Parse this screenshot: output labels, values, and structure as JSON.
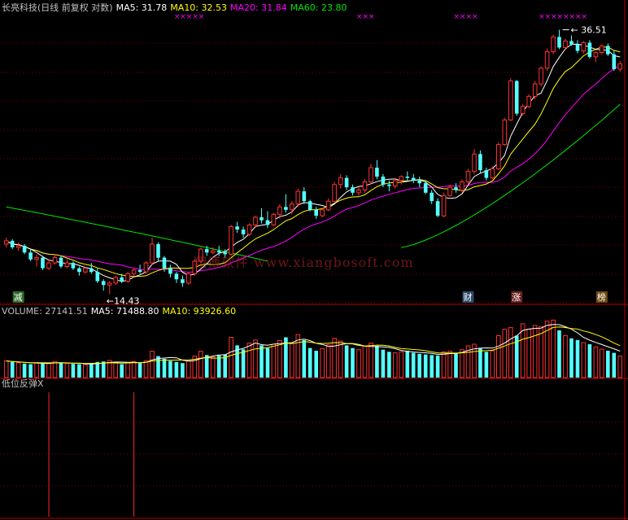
{
  "colors": {
    "background": "#000000",
    "up": "#ff3232",
    "down": "#54ffff",
    "frame": "#b00000",
    "ma5": "#ffffff",
    "ma10": "#ffff00",
    "ma20": "#ff00ff",
    "ma60": "#00e600",
    "title": "#c0c0c0",
    "signal": "#ff2020"
  },
  "header": {
    "title": "长亮科技(日线 前复权 对数)",
    "ma5": "MA5: 31.78",
    "ma10": "MA10: 32.53",
    "ma20": "MA20: 31.84",
    "ma60": "MA60: 23.80"
  },
  "volume_header": {
    "title": "VOLUME: 27141.51",
    "ma5": "MA5: 71488.80",
    "ma10": "MA10: 93926.60"
  },
  "indicator_header": {
    "title": "低位反弹X"
  },
  "watermark": "翔博软件 www.xiangbosoft.com",
  "chart_data": {
    "type": "candlestick",
    "annotations": {
      "high": "36.51",
      "low": "14.43"
    },
    "badges": [
      "减",
      "财",
      "涨",
      "榜"
    ],
    "price_range_visible": [
      14.0,
      38.5
    ],
    "candles": [
      [
        17.2,
        17.6,
        17.0,
        17.4
      ],
      [
        17.4,
        17.5,
        16.9,
        17.0
      ],
      [
        17.0,
        17.3,
        16.8,
        17.1
      ],
      [
        17.1,
        17.2,
        16.6,
        16.7
      ],
      [
        16.7,
        16.9,
        16.2,
        16.3
      ],
      [
        16.3,
        16.6,
        15.9,
        16.4
      ],
      [
        16.4,
        16.5,
        15.7,
        15.8
      ],
      [
        15.8,
        16.3,
        15.7,
        16.1
      ],
      [
        16.1,
        16.6,
        16.0,
        16.4
      ],
      [
        16.4,
        16.5,
        15.8,
        15.9
      ],
      [
        15.9,
        16.3,
        15.8,
        16.1
      ],
      [
        16.1,
        16.2,
        15.7,
        15.8
      ],
      [
        15.8,
        15.9,
        15.4,
        15.6
      ],
      [
        15.6,
        15.9,
        15.5,
        15.8
      ],
      [
        15.8,
        16.1,
        15.5,
        15.6
      ],
      [
        15.6,
        15.8,
        15.0,
        15.1
      ],
      [
        15.1,
        15.2,
        14.6,
        14.9
      ],
      [
        14.9,
        15.1,
        14.43,
        15.0
      ],
      [
        15.0,
        15.4,
        14.9,
        15.3
      ],
      [
        15.3,
        15.5,
        15.0,
        15.1
      ],
      [
        15.1,
        15.6,
        15.0,
        15.5
      ],
      [
        15.5,
        15.8,
        15.3,
        15.7
      ],
      [
        15.7,
        16.0,
        15.5,
        15.6
      ],
      [
        15.6,
        16.2,
        15.5,
        16.1
      ],
      [
        16.1,
        17.6,
        16.0,
        17.2
      ],
      [
        17.2,
        17.3,
        16.2,
        16.4
      ],
      [
        16.4,
        16.5,
        15.6,
        15.8
      ],
      [
        15.8,
        16.0,
        15.3,
        15.5
      ],
      [
        15.5,
        15.6,
        15.0,
        15.2
      ],
      [
        15.2,
        15.4,
        14.8,
        15.0
      ],
      [
        15.0,
        15.6,
        14.9,
        15.5
      ],
      [
        15.5,
        16.3,
        15.4,
        16.2
      ],
      [
        16.2,
        17.0,
        16.1,
        16.9
      ],
      [
        16.9,
        17.1,
        16.5,
        16.7
      ],
      [
        16.7,
        17.0,
        16.6,
        16.8
      ],
      [
        16.8,
        17.1,
        16.5,
        16.7
      ],
      [
        16.7,
        16.9,
        16.4,
        16.6
      ],
      [
        16.6,
        18.4,
        16.5,
        18.3
      ],
      [
        18.3,
        18.6,
        17.9,
        18.1
      ],
      [
        18.1,
        18.3,
        17.6,
        17.8
      ],
      [
        17.8,
        18.5,
        17.7,
        18.4
      ],
      [
        18.4,
        19.0,
        18.2,
        18.9
      ],
      [
        18.9,
        19.5,
        18.5,
        18.7
      ],
      [
        18.7,
        19.3,
        18.2,
        18.4
      ],
      [
        18.4,
        19.2,
        18.3,
        19.1
      ],
      [
        19.1,
        19.8,
        18.8,
        19.6
      ],
      [
        19.6,
        20.5,
        19.2,
        19.4
      ],
      [
        19.4,
        20.0,
        19.1,
        19.8
      ],
      [
        19.8,
        20.9,
        19.6,
        20.7
      ],
      [
        20.7,
        21.0,
        19.8,
        20.0
      ],
      [
        20.0,
        20.1,
        19.3,
        19.4
      ],
      [
        19.4,
        19.6,
        18.8,
        19.0
      ],
      [
        19.0,
        19.5,
        18.9,
        19.4
      ],
      [
        19.4,
        20.2,
        19.3,
        20.0
      ],
      [
        20.0,
        21.4,
        19.9,
        21.2
      ],
      [
        21.2,
        22.0,
        20.9,
        21.7
      ],
      [
        21.7,
        21.9,
        20.8,
        21.0
      ],
      [
        21.0,
        21.2,
        20.4,
        20.6
      ],
      [
        20.6,
        21.0,
        20.3,
        20.8
      ],
      [
        20.8,
        21.6,
        20.6,
        21.4
      ],
      [
        21.4,
        22.8,
        21.2,
        22.5
      ],
      [
        22.5,
        23.1,
        21.6,
        21.8
      ],
      [
        21.8,
        22.0,
        21.0,
        21.2
      ],
      [
        21.2,
        21.5,
        20.7,
        21.1
      ],
      [
        21.1,
        21.7,
        20.9,
        21.5
      ],
      [
        21.5,
        21.9,
        21.2,
        21.8
      ],
      [
        21.8,
        22.2,
        21.5,
        21.7
      ],
      [
        21.7,
        22.0,
        21.3,
        21.5
      ],
      [
        21.5,
        21.8,
        21.0,
        21.3
      ],
      [
        21.3,
        21.5,
        20.5,
        20.6
      ],
      [
        20.6,
        20.8,
        19.8,
        20.0
      ],
      [
        20.0,
        20.2,
        18.9,
        19.0
      ],
      [
        19.0,
        20.6,
        18.9,
        20.4
      ],
      [
        20.4,
        21.2,
        20.3,
        21.0
      ],
      [
        21.0,
        21.3,
        20.6,
        20.8
      ],
      [
        20.8,
        21.6,
        20.6,
        21.4
      ],
      [
        21.4,
        22.4,
        21.2,
        22.2
      ],
      [
        22.2,
        24.0,
        22.0,
        23.6
      ],
      [
        23.6,
        23.9,
        22.1,
        22.3
      ],
      [
        22.3,
        22.5,
        21.5,
        21.7
      ],
      [
        21.7,
        22.6,
        21.6,
        22.4
      ],
      [
        22.4,
        24.6,
        22.3,
        24.4
      ],
      [
        24.4,
        26.8,
        24.3,
        26.6
      ],
      [
        26.6,
        30.8,
        26.5,
        30.5
      ],
      [
        30.5,
        30.6,
        27.0,
        27.2
      ],
      [
        27.2,
        28.1,
        27.0,
        27.9
      ],
      [
        27.9,
        29.1,
        27.7,
        28.9
      ],
      [
        28.9,
        30.5,
        28.6,
        30.2
      ],
      [
        30.2,
        32.1,
        29.9,
        31.9
      ],
      [
        31.9,
        34.2,
        31.6,
        33.8
      ],
      [
        33.8,
        35.9,
        33.5,
        35.6
      ],
      [
        35.6,
        36.51,
        34.1,
        34.3
      ],
      [
        34.3,
        35.4,
        34.0,
        35.1
      ],
      [
        35.1,
        35.8,
        34.5,
        34.7
      ],
      [
        34.7,
        35.2,
        33.6,
        33.9
      ],
      [
        33.9,
        35.1,
        33.6,
        34.9
      ],
      [
        34.9,
        35.2,
        33.0,
        33.2
      ],
      [
        33.2,
        33.9,
        32.6,
        33.7
      ],
      [
        33.7,
        34.7,
        33.5,
        34.5
      ],
      [
        34.5,
        34.8,
        33.3,
        33.5
      ],
      [
        33.5,
        34.0,
        31.6,
        31.8
      ],
      [
        31.8,
        32.7,
        31.5,
        32.4
      ]
    ],
    "volume": [
      62000,
      58000,
      55000,
      52000,
      50000,
      56000,
      54000,
      52000,
      60000,
      55000,
      52000,
      51000,
      50000,
      48000,
      52000,
      58000,
      60000,
      64000,
      55000,
      50000,
      56000,
      60000,
      54000,
      62000,
      98000,
      80000,
      70000,
      62000,
      58000,
      54000,
      62000,
      80000,
      98000,
      84000,
      76000,
      82000,
      86000,
      150000,
      120000,
      105000,
      128000,
      140000,
      120000,
      110000,
      124000,
      138000,
      150000,
      128000,
      160000,
      140000,
      110000,
      100000,
      108000,
      122000,
      146000,
      136000,
      120000,
      110000,
      104000,
      116000,
      128000,
      118000,
      104000,
      96000,
      92000,
      96000,
      100000,
      92000,
      88000,
      86000,
      84000,
      82000,
      96000,
      98000,
      90000,
      104000,
      118000,
      124000,
      110000,
      96000,
      100000,
      156000,
      180000,
      186000,
      156000,
      200000,
      180000,
      194000,
      190000,
      210000,
      214000,
      176000,
      156000,
      146000,
      140000,
      130000,
      124000,
      114000,
      106000,
      100000,
      92000,
      80000
    ],
    "volume_ylim": [
      0,
      218000
    ],
    "volume_down_last": true,
    "signals": [
      7,
      21
    ],
    "ma60_start_index": 65,
    "ma60_end_value": 28.1
  }
}
